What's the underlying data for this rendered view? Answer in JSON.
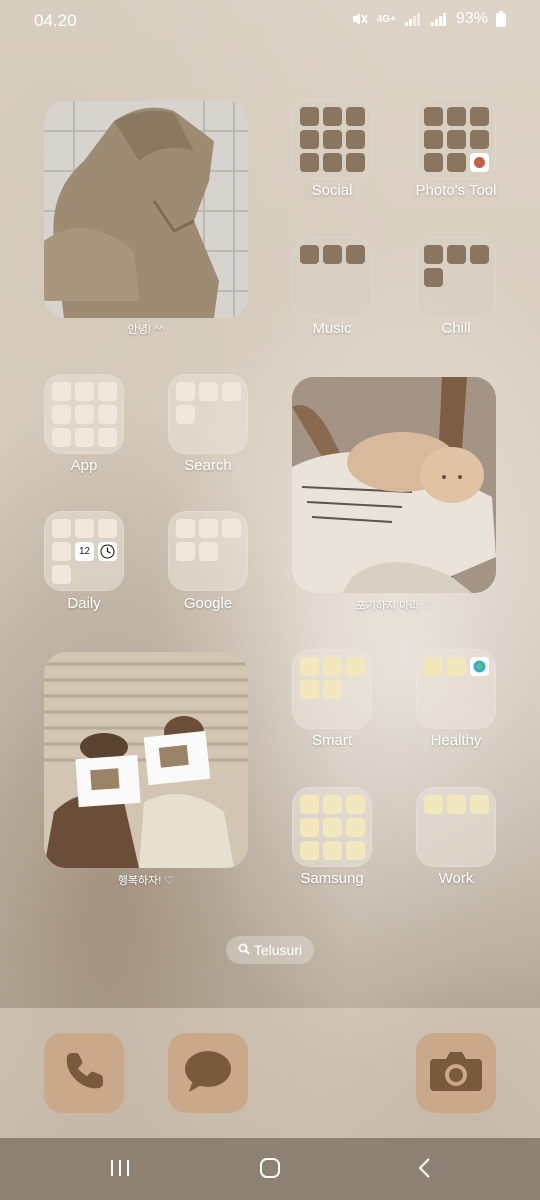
{
  "status_bar": {
    "time": "04.20",
    "network": "4G+",
    "battery": "93%"
  },
  "folders": [
    {
      "id": "social",
      "label": "Social"
    },
    {
      "id": "photos-tool",
      "label": "Photo's Tool"
    },
    {
      "id": "music",
      "label": "Music"
    },
    {
      "id": "chill",
      "label": "Chill"
    },
    {
      "id": "app",
      "label": "App"
    },
    {
      "id": "search",
      "label": "Search"
    },
    {
      "id": "daily",
      "label": "Daily",
      "calendar_day": "12"
    },
    {
      "id": "google",
      "label": "Google"
    },
    {
      "id": "smart",
      "label": "Smart"
    },
    {
      "id": "healthy",
      "label": "Healthy"
    },
    {
      "id": "samsung",
      "label": "Samsung"
    },
    {
      "id": "work",
      "label": "Work"
    }
  ],
  "widgets": [
    {
      "id": "hoodie",
      "caption": "안녕! ^^"
    },
    {
      "id": "cat",
      "caption": "포기하지 마라 ♡"
    },
    {
      "id": "couple",
      "caption": "행복하자! ♡"
    }
  ],
  "search_pill": {
    "label": "Telusuri",
    "icon": "search-icon"
  },
  "dock": [
    {
      "name": "phone",
      "icon": "phone-icon"
    },
    {
      "name": "messages",
      "icon": "message-icon"
    },
    {
      "name": "camera",
      "icon": "camera-icon"
    }
  ],
  "nav": {
    "recents": "recents-icon",
    "home": "home-icon",
    "back": "back-icon"
  },
  "colors": {
    "folder_brown": "#8a7560",
    "folder_cream": "#f1e7dc",
    "folder_yellow": "#f3e7bd",
    "dock_tile": "#c9a98a",
    "navbar": "#8e8173"
  }
}
